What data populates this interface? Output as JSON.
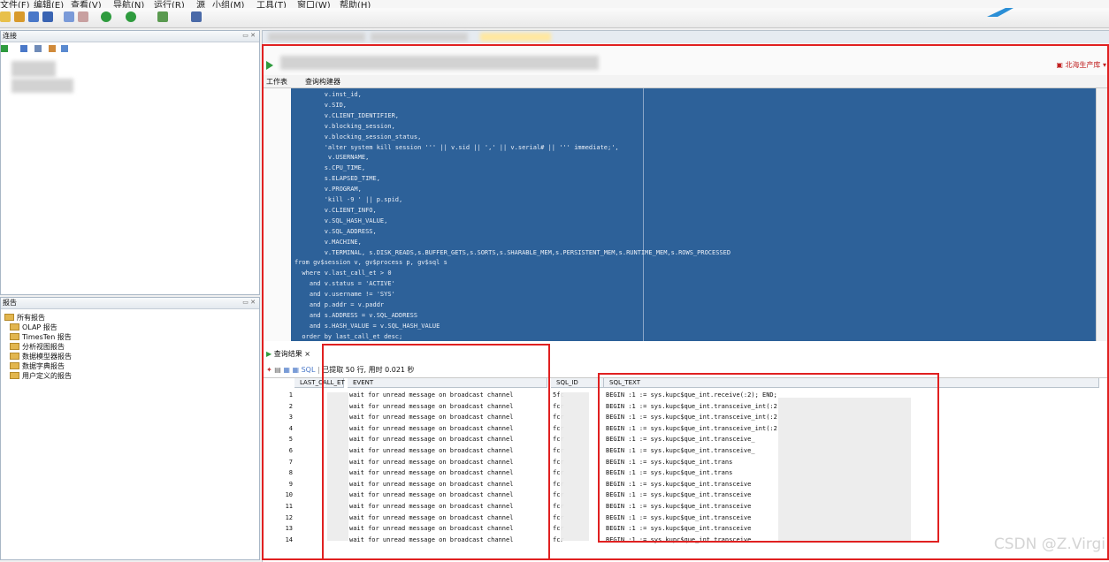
{
  "menu": [
    "文件(F)",
    "编辑(E)",
    "查看(V)",
    "导航(N)",
    "运行(R)",
    "源",
    "小组(M)",
    "工具(T)",
    "窗口(W)",
    "帮助(H)"
  ],
  "left_panels": {
    "connections_title": "连接",
    "reports_title": "报告",
    "reports": [
      "所有报告",
      "OLAP 报告",
      "TimesTen 报告",
      "分析视图报告",
      "数据模型器报告",
      "数据字典报告",
      "用户定义的报告"
    ]
  },
  "editor": {
    "connection_label": "北海生产库",
    "subtabs": [
      "工作表",
      "查询构建器"
    ],
    "sql_lines": [
      "        v.inst_id,",
      "        v.SID,",
      "        v.CLIENT_IDENTIFIER,",
      "        v.blocking_session,",
      "        v.blocking_session_status,",
      "        'alter system kill session ''' || v.sid || ',' || v.serial# || ''' immediate;',",
      "         v.USERNAME,",
      "        s.CPU_TIME,",
      "        s.ELAPSED_TIME,",
      "        v.PROGRAM,",
      "        'kill -9 ' || p.spid,",
      "        v.CLIENT_INFO,",
      "        v.SQL_HASH_VALUE,",
      "        v.SQL_ADDRESS,",
      "        v.MACHINE,",
      "        v.TERMINAL, s.DISK_READS,s.BUFFER_GETS,s.SORTS,s.SHARABLE_MEM,s.PERSISTENT_MEM,s.RUNTIME_MEM,s.ROWS_PROCESSED",
      "from gv$session v, gv$process p, gv$sql s",
      "  where v.last_call_et > 0",
      "    and v.status = 'ACTIVE'",
      "    and v.username != 'SYS'",
      "    and p.addr = v.paddr",
      "    and s.ADDRESS = v.SQL_ADDRESS",
      "    and s.HASH_VALUE = v.SQL_HASH_VALUE",
      "  order by last_call_et desc;"
    ]
  },
  "results": {
    "tab_label": "查询结果",
    "tab_close": "×",
    "sql_label": "SQL",
    "status": "已提取 50 行, 用时 0.021 秒",
    "columns": [
      "LAST_CALL_ET",
      "EVENT",
      "SQL_ID",
      "SQL_TEXT"
    ],
    "rows": [
      {
        "n": "1",
        "event": "wait for unread message on broadcast channel",
        "sql_id": "5fc",
        "text": "BEGIN :1 := sys.kupc$que_int.receive(:2); END;"
      },
      {
        "n": "2",
        "event": "wait for unread message on broadcast channel",
        "sql_id": "fcr",
        "text": "BEGIN :1 := sys.kupc$que_int.transceive_int(:2"
      },
      {
        "n": "3",
        "event": "wait for unread message on broadcast channel",
        "sql_id": "fcr",
        "text": "BEGIN :1 := sys.kupc$que_int.transceive_int(:2"
      },
      {
        "n": "4",
        "event": "wait for unread message on broadcast channel",
        "sql_id": "fcr",
        "text": "BEGIN :1 := sys.kupc$que_int.transceive_int(:2"
      },
      {
        "n": "5",
        "event": "wait for unread message on broadcast channel",
        "sql_id": "fcr",
        "text": "BEGIN :1 := sys.kupc$que_int.transceive_"
      },
      {
        "n": "6",
        "event": "wait for unread message on broadcast channel",
        "sql_id": "fcr",
        "text": "BEGIN :1 := sys.kupc$que_int.transceive_"
      },
      {
        "n": "7",
        "event": "wait for unread message on broadcast channel",
        "sql_id": "fcr",
        "text": "BEGIN :1 := sys.kupc$que_int.trans"
      },
      {
        "n": "8",
        "event": "wait for unread message on broadcast channel",
        "sql_id": "fcr",
        "text": "BEGIN :1 := sys.kupc$que_int.trans"
      },
      {
        "n": "9",
        "event": "wait for unread message on broadcast channel",
        "sql_id": "fcr",
        "text": "BEGIN :1 := sys.kupc$que_int.transceive"
      },
      {
        "n": "10",
        "event": "wait for unread message on broadcast channel",
        "sql_id": "fcr",
        "text": "BEGIN :1 := sys.kupc$que_int.transceive"
      },
      {
        "n": "11",
        "event": "wait for unread message on broadcast channel",
        "sql_id": "fcr",
        "text": "BEGIN :1 := sys.kupc$que_int.transceive"
      },
      {
        "n": "12",
        "event": "wait for unread message on broadcast channel",
        "sql_id": "fcr",
        "text": "BEGIN :1 := sys.kupc$que_int.transceive"
      },
      {
        "n": "13",
        "event": "wait for unread message on broadcast channel",
        "sql_id": "fcr",
        "text": "BEGIN :1 := sys.kupc$que_int.transceive"
      },
      {
        "n": "14",
        "event": "wait for unread message on broadcast channel",
        "sql_id": "fcr",
        "text": "BEGIN :1 := sys.kupc$que_int.transceive"
      }
    ]
  },
  "watermark": "CSDN @Z.Virgi",
  "colors": {
    "editor_bg": "#2d6199",
    "highlight": "#e02020"
  }
}
